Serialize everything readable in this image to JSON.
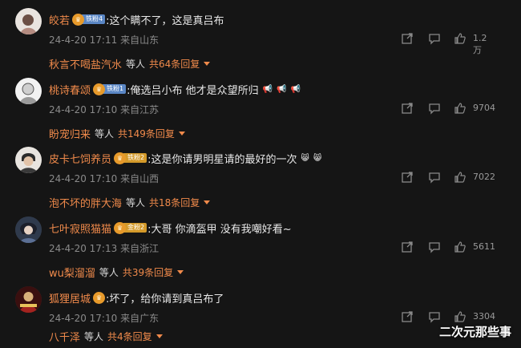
{
  "comments": [
    {
      "user": "皎若",
      "badge": {
        "text": "铁粉4",
        "color": "blue"
      },
      "text": ":这个瞒不了，这是真吕布",
      "date": "24-4-20 17:11",
      "location": "来自山东",
      "likes": "1.2万",
      "replier": "秋言不喝盐汽水",
      "etc": "等人",
      "reply_count": "共64条回复",
      "avatar": "avatar-girl-portrait"
    },
    {
      "user": "桃诗春颂",
      "badge": {
        "text": "铁粉1",
        "color": "blue"
      },
      "text": ":俺选吕小布 他才是众望所归",
      "emoji": [
        "📢",
        "📢",
        "📢"
      ],
      "date": "24-4-20 17:10",
      "location": "来自江苏",
      "likes": "9704",
      "replier": "盼宠归来",
      "etc": "等人",
      "reply_count": "共149条回复",
      "avatar": "avatar-sketch-portrait"
    },
    {
      "user": "皮卡七饲养员",
      "badge": {
        "text": "铁粉2",
        "color": "gold"
      },
      "text": ":这是你请男明星请的最好的一次",
      "emoji": [
        "😸",
        "😸"
      ],
      "date": "24-4-20 17:10",
      "location": "来自山西",
      "likes": "7022",
      "replier": "泡不坏的胖大海",
      "etc": "等人",
      "reply_count": "共18条回复",
      "avatar": "avatar-boy-portrait"
    },
    {
      "user": "七叶寂照猫猫",
      "badge": {
        "text": "金粉2",
        "color": "gold"
      },
      "text": ":大哥 你滴盔甲  没有我嘲好看~",
      "date": "24-4-20 17:13",
      "location": "来自浙江",
      "likes": "5611",
      "replier": "wu梨溜溜",
      "etc": "等人",
      "reply_count": "共39条回复",
      "avatar": "avatar-anime-portrait"
    },
    {
      "user": "狐狸居城",
      "text": ":坏了，给你请到真吕布了",
      "date": "24-4-20 17:10",
      "location": "来自广东",
      "likes": "3304",
      "replier": "八千泽",
      "etc": "等人",
      "reply_count": "共4条回复",
      "avatar": "avatar-red-portrait"
    }
  ],
  "watermark": "二次元那些事",
  "colors": {
    "background": "#151515",
    "username": "#f08a4b",
    "meta": "#8a8a8a"
  },
  "icons": {
    "share": "share-icon",
    "reply": "comment-icon",
    "like": "thumbs-up-icon"
  }
}
